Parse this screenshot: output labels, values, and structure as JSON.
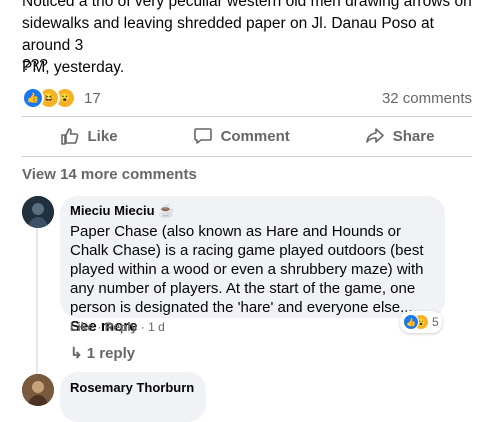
{
  "post": {
    "line1": "Noticed a trio of very peculiar western old men drawing arrows on",
    "line2": "sidewalks and leaving shredded paper on Jl. Danau Poso at around 3",
    "line3": "PM, yesterday.",
    "extra": "???"
  },
  "stats": {
    "reaction_count": "17",
    "comments_label": "32 comments"
  },
  "actions": {
    "like": "Like",
    "comment": "Comment",
    "share": "Share"
  },
  "view_more": "View 14 more comments",
  "comment1": {
    "author": "Mieciu Mieciu",
    "author_emoji": "☕",
    "text": "Paper Chase (also known as Hare and Hounds or Chalk Chase) is a racing game played outdoors (best played within a wood or even a shrubbery maze) with any number of players. At the start of the game, one person is designated the 'hare' and everyone else...",
    "see_more": "See more",
    "like": "Like",
    "reply": "Reply",
    "time": "1 d",
    "reaction_count": "5",
    "replies": "↳ 1 reply"
  },
  "comment2": {
    "author": "Rosemary Thorburn"
  },
  "colors": {
    "accent": "#1877f2",
    "muted": "#65676b",
    "bubble": "#f0f2f5"
  }
}
